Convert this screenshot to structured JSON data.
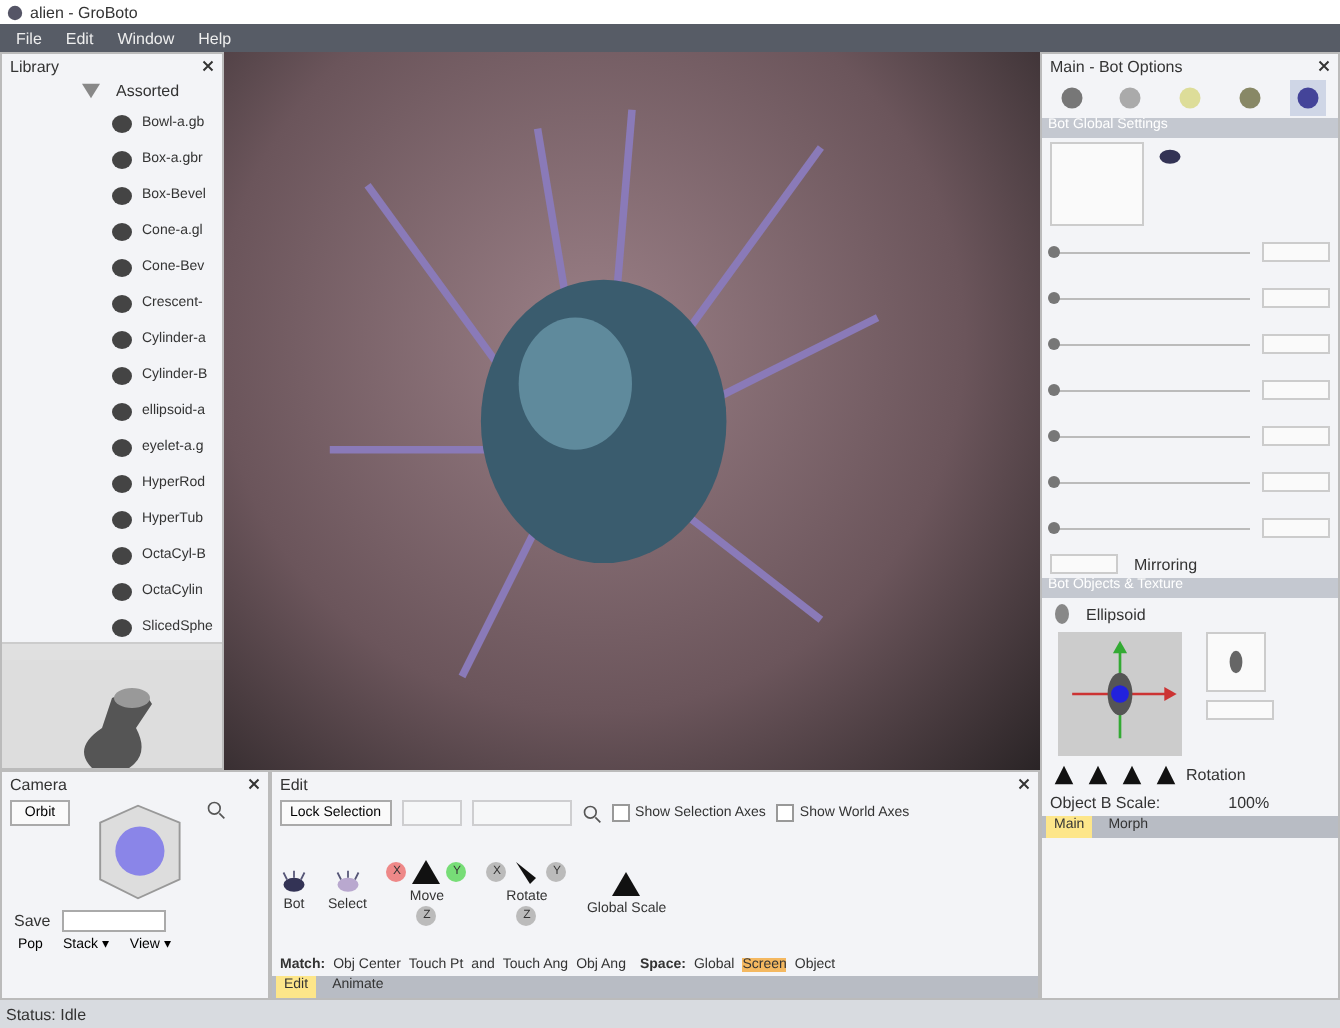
{
  "window": {
    "title": "alien - GroBoto"
  },
  "menu": [
    "File",
    "Edit",
    "Window",
    "Help"
  ],
  "library": {
    "title": "Library",
    "folder": {
      "label": "Assorted",
      "expanded": true
    },
    "items": [
      {
        "label": "Bowl-a.gb"
      },
      {
        "label": "Box-a.gbr"
      },
      {
        "label": "Box-Bevel"
      },
      {
        "label": "Cone-a.gl"
      },
      {
        "label": "Cone-Bev"
      },
      {
        "label": "Crescent-"
      },
      {
        "label": "Cylinder-a"
      },
      {
        "label": "Cylinder-B"
      },
      {
        "label": "ellipsoid-a"
      },
      {
        "label": "eyelet-a.g"
      },
      {
        "label": "HyperRod"
      },
      {
        "label": "HyperTub"
      },
      {
        "label": "OctaCyl-B"
      },
      {
        "label": "OctaCylin"
      },
      {
        "label": "SlicedSphe"
      }
    ]
  },
  "camera": {
    "title": "Camera",
    "orbit": "Orbit",
    "save": "Save",
    "pop": "Pop",
    "stack": "Stack ▾",
    "view": "View ▾"
  },
  "edit": {
    "title": "Edit",
    "lock": "Lock Selection",
    "checks": [
      {
        "label": "Show Selection Axes",
        "checked": false
      },
      {
        "label": "Show World Axes",
        "checked": false
      }
    ],
    "tools": [
      {
        "kind": "bot",
        "label": "Bot"
      },
      {
        "kind": "select",
        "label": "Select"
      },
      {
        "kind": "move",
        "label": "Move",
        "axes": [
          "X",
          "Y",
          "Z"
        ]
      },
      {
        "kind": "rotate",
        "label": "Rotate",
        "axes": [
          "X",
          "Y",
          "Z"
        ]
      },
      {
        "kind": "scale",
        "label": "Global Scale"
      }
    ],
    "match_label": "Match:",
    "match": [
      {
        "label": "Obj Center"
      },
      {
        "label": "Touch Pt"
      },
      {
        "label": "and"
      },
      {
        "label": "Touch Ang"
      },
      {
        "label": "Obj Ang"
      }
    ],
    "space_label": "Space:",
    "space": [
      {
        "label": "Global",
        "selected": false
      },
      {
        "label": "Screen",
        "selected": true
      },
      {
        "label": "Object",
        "selected": false
      }
    ],
    "tabs": [
      {
        "label": "Edit",
        "selected": true
      },
      {
        "label": "Animate",
        "selected": false
      }
    ]
  },
  "options": {
    "title": "Main - Bot Options",
    "icon_tabs": [
      {
        "selected": false
      },
      {
        "selected": false
      },
      {
        "selected": false
      },
      {
        "selected": false
      },
      {
        "selected": true
      }
    ],
    "global_header": "Bot Global Settings",
    "sliders": [
      {
        "level": 0
      },
      {
        "level": 0
      },
      {
        "level": 0
      },
      {
        "level": 0
      },
      {
        "level": 0
      },
      {
        "level": 0
      },
      {
        "level": 0
      }
    ],
    "mirroring": "Mirroring",
    "objects_header": "Bot Objects & Texture",
    "object": "Ellipsoid",
    "rotation": "Rotation",
    "scale_label": "Object B Scale:",
    "scale_value": "100%",
    "tabs": [
      {
        "label": "Main",
        "selected": true
      },
      {
        "label": "Morph",
        "selected": false
      }
    ]
  },
  "status": "Status: Idle"
}
